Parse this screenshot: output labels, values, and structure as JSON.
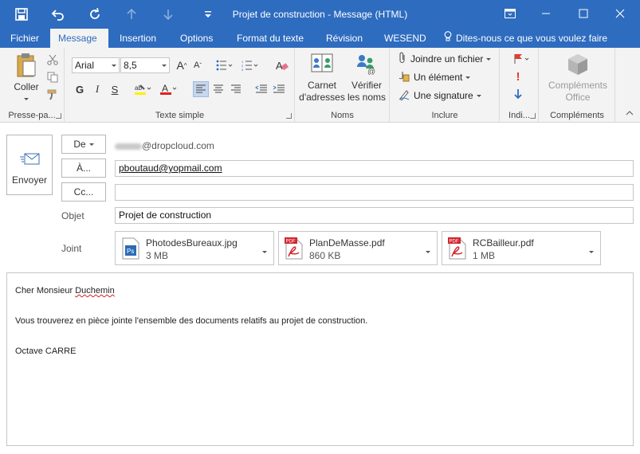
{
  "window": {
    "title": "Projet de construction - Message (HTML)"
  },
  "menu": {
    "tabs": [
      "Fichier",
      "Message",
      "Insertion",
      "Options",
      "Format du texte",
      "Révision",
      "WESEND"
    ],
    "tell_me": "Dites-nous ce que vous voulez faire",
    "active_tab": "Message"
  },
  "ribbon": {
    "clipboard": {
      "paste_label": "Coller",
      "group_label": "Presse-pa..."
    },
    "basic_text": {
      "font_name": "Arial",
      "font_size": "8,5",
      "group_label": "Texte simple"
    },
    "names": {
      "address_book": "Carnet\nd'adresses",
      "address_book_l1": "Carnet",
      "address_book_l2": "d'adresses",
      "check_names_l1": "Vérifier",
      "check_names_l2": "les noms",
      "group_label": "Noms"
    },
    "include": {
      "attach_file": "Joindre un fichier",
      "attach_item": "Un élément",
      "signature": "Une signature",
      "group_label": "Inclure"
    },
    "tags": {
      "group_label": "Indi..."
    },
    "addins": {
      "office_addins_l1": "Compléments",
      "office_addins_l2": "Office",
      "group_label": "Compléments"
    }
  },
  "header": {
    "send_label": "Envoyer",
    "from_label": "De",
    "from_email": "@dropcloud.com",
    "to_label": "À...",
    "to_value": "pboutaud@yopmail.com",
    "cc_label": "Cc...",
    "cc_value": "",
    "subject_label": "Objet",
    "subject_value": "Projet de construction",
    "attach_label": "Joint"
  },
  "attachments": [
    {
      "name": "PhotodesBureaux.jpg",
      "size": "3 MB",
      "icon": "photoshop-file-icon"
    },
    {
      "name": "PlanDeMasse.pdf",
      "size": "860 KB",
      "icon": "pdf-file-icon"
    },
    {
      "name": "RCBailleur.pdf",
      "size": "1 MB",
      "icon": "pdf-file-icon"
    }
  ],
  "body": {
    "greeting_prefix": "Cher Monsieur ",
    "greeting_name": "Duchemin",
    "paragraph": "Vous trouverez en pièce jointe l'ensemble des documents relatifs au projet de construction.",
    "signature": "Octave CARRE"
  },
  "colors": {
    "accent": "#2e6cbf",
    "ribbon_bg": "#f3f3f3",
    "pdf_red": "#d0262d",
    "photoshop_blue": "#2a6cb5"
  }
}
